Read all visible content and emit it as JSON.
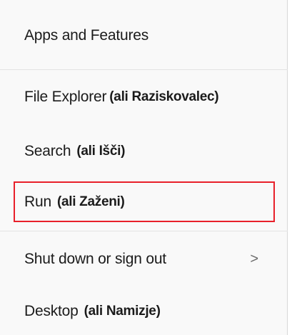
{
  "menu": {
    "items": [
      {
        "label": "Apps and Features",
        "alt": ""
      },
      {
        "label": "File Explorer",
        "alt": "(ali Raziskovalec)"
      },
      {
        "label": "Search",
        "alt": "(ali Išči)"
      },
      {
        "label": "Run",
        "alt": "(ali Zaženi)"
      },
      {
        "label": "Shut down or sign out",
        "alt": "",
        "chevron": "chevron-right-icon"
      },
      {
        "label": "Desktop",
        "alt": "(ali Namizje)"
      }
    ],
    "chevron_glyph": ">"
  },
  "colors": {
    "highlight": "#e8202a",
    "background": "#f9f9f9",
    "separator": "#e3e3e3"
  }
}
